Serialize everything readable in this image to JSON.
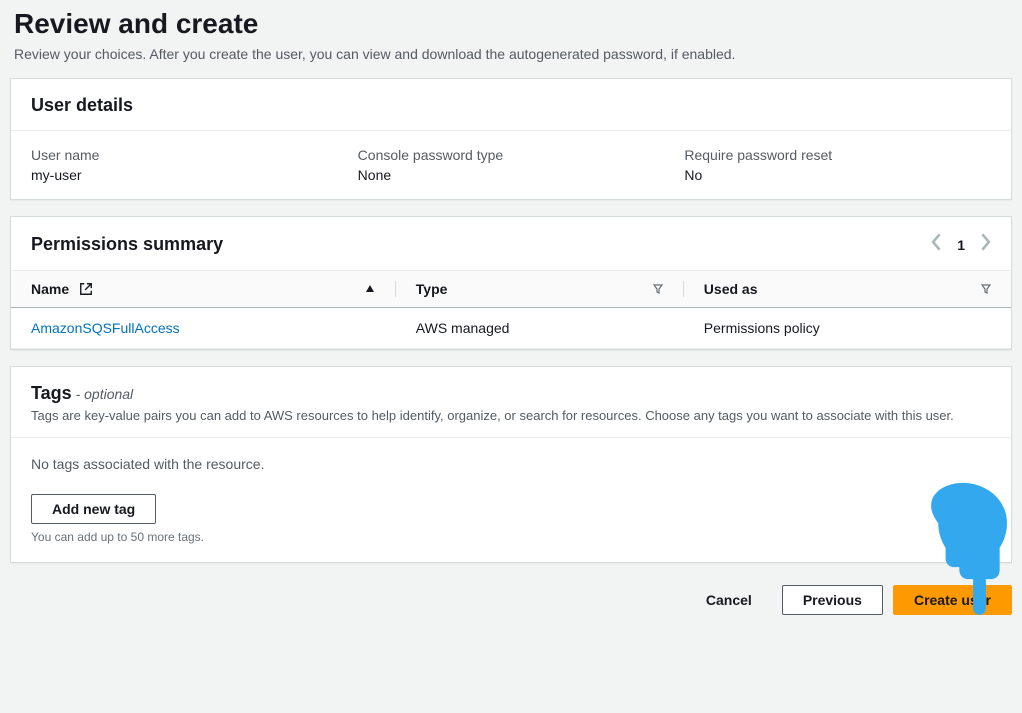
{
  "header": {
    "title": "Review and create",
    "description": "Review your choices. After you create the user, you can view and download the autogenerated password, if enabled."
  },
  "user_details": {
    "title": "User details",
    "username_label": "User name",
    "username_value": "my-user",
    "pwd_type_label": "Console password type",
    "pwd_type_value": "None",
    "require_reset_label": "Require password reset",
    "require_reset_value": "No"
  },
  "permissions": {
    "title": "Permissions summary",
    "page": "1",
    "columns": {
      "name": "Name",
      "type": "Type",
      "used_as": "Used as"
    },
    "rows": [
      {
        "name": "AmazonSQSFullAccess",
        "type": "AWS managed",
        "used_as": "Permissions policy"
      }
    ]
  },
  "tags": {
    "title": "Tags",
    "optional": " - optional",
    "description": "Tags are key-value pairs you can add to AWS resources to help identify, organize, or search for resources. Choose any tags you want to associate with this user.",
    "empty": "No tags associated with the resource.",
    "add_button": "Add new tag",
    "hint": "You can add up to 50 more tags."
  },
  "footer": {
    "cancel": "Cancel",
    "previous": "Previous",
    "create": "Create user"
  }
}
